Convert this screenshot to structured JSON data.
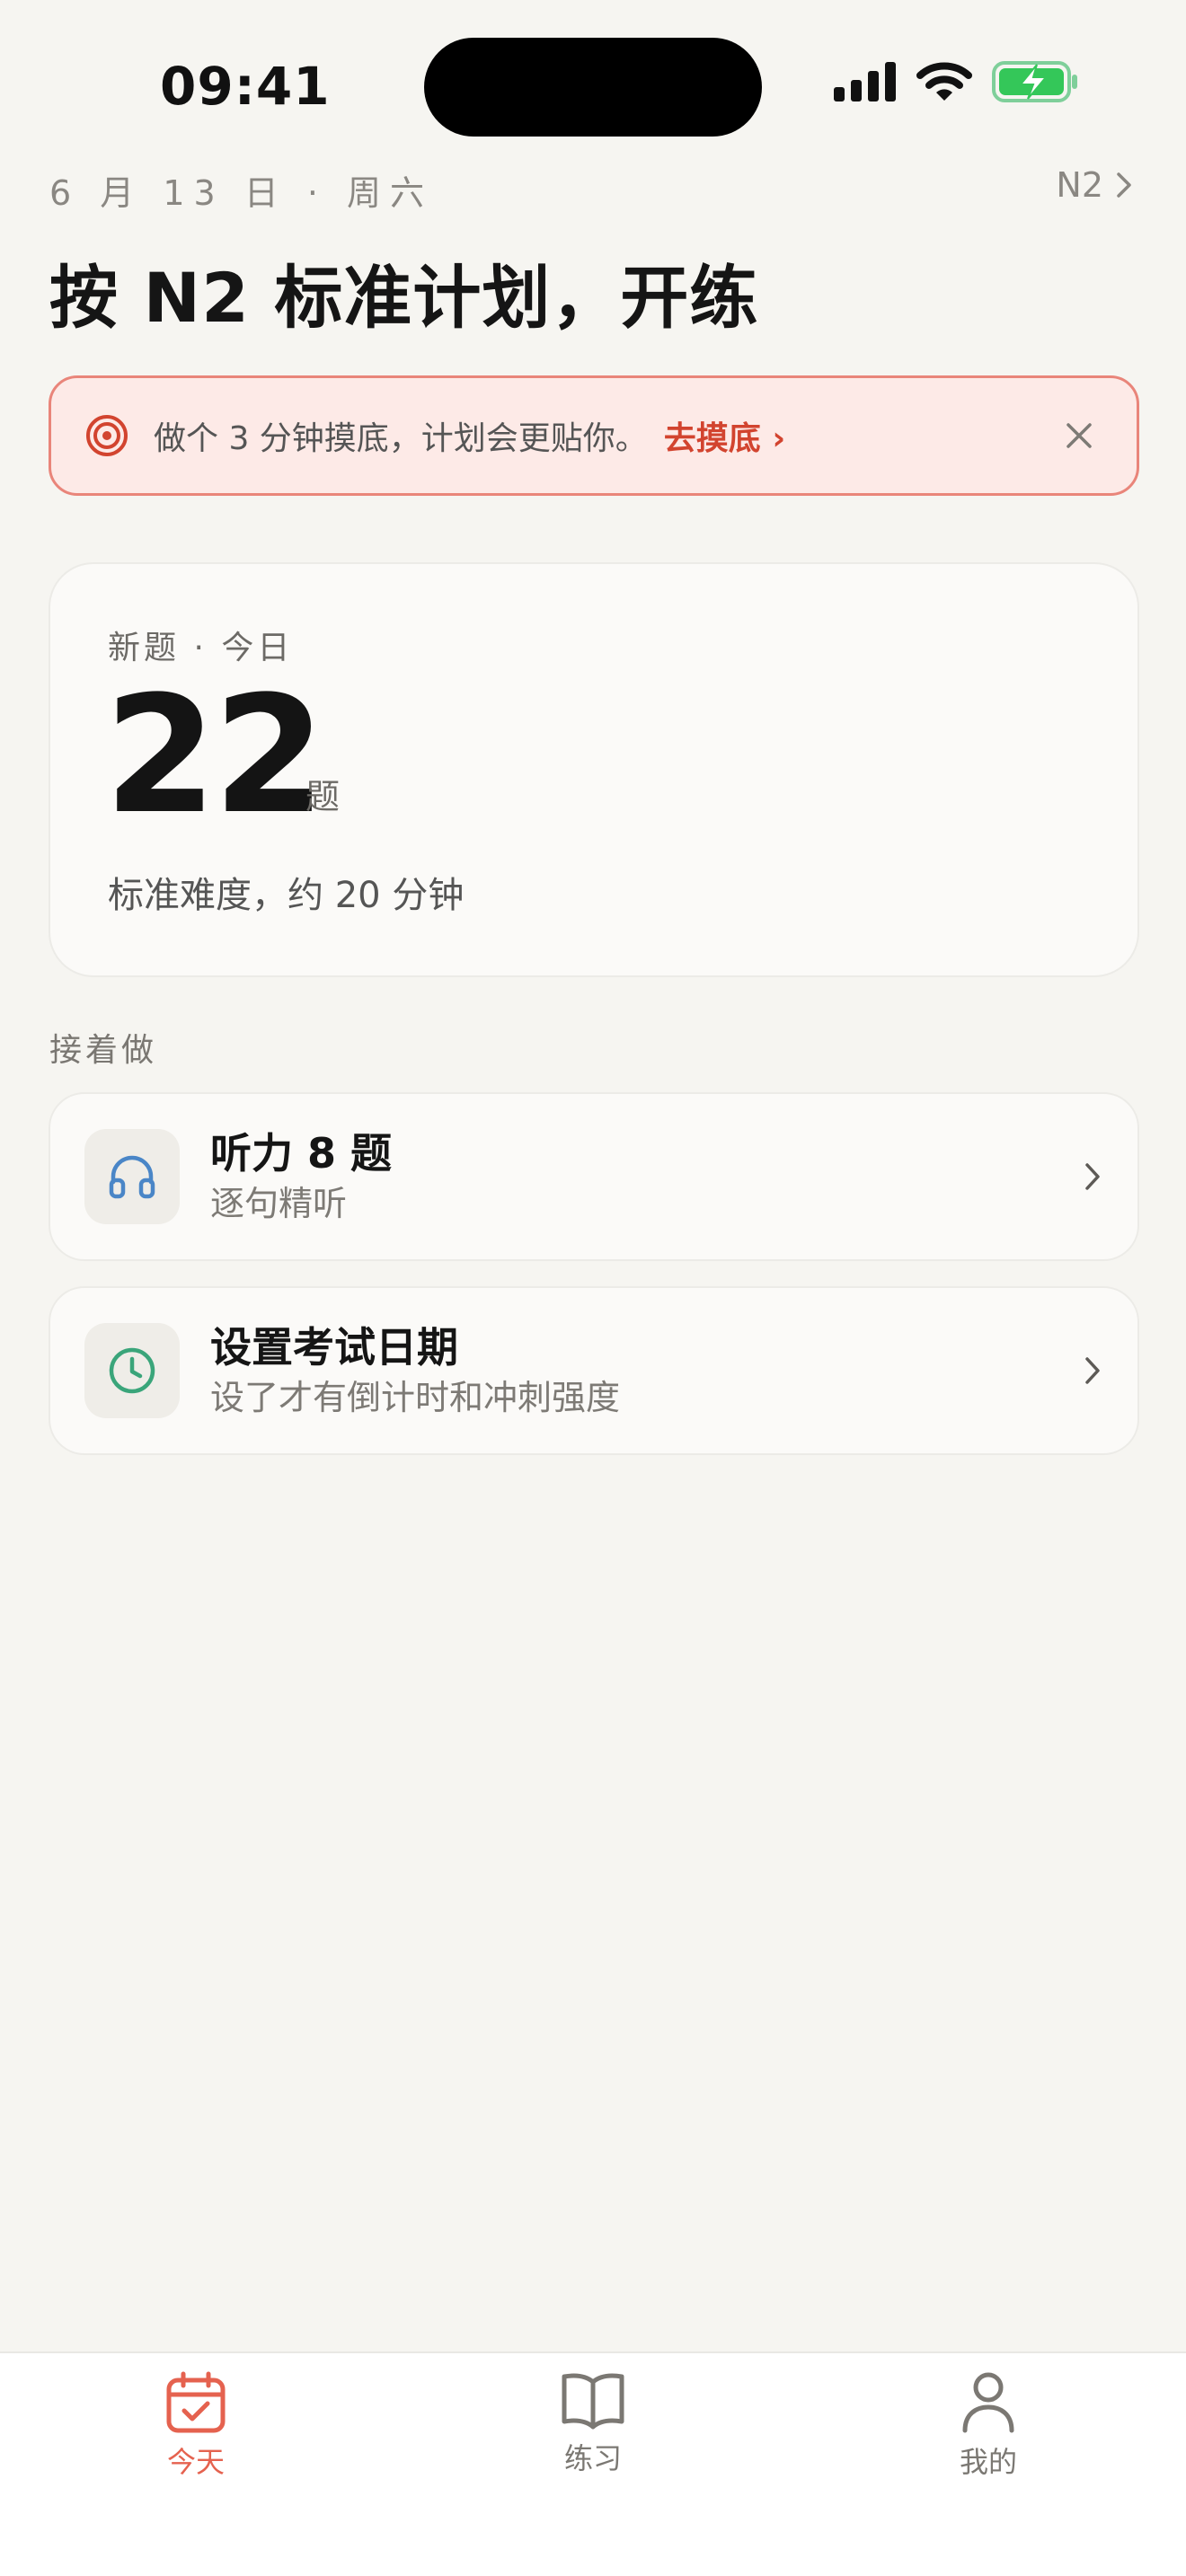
{
  "status_bar": {
    "time": "09:41",
    "icons": [
      "cellular-signal-icon",
      "wifi-icon",
      "battery-charging-icon"
    ]
  },
  "header": {
    "date": "6 月 13 日 · 周六",
    "level": "N2",
    "title": "按 N2 标准计划，开练"
  },
  "banner": {
    "text": "做个 3 分钟摸底，计划会更贴你。",
    "link": "去摸底 ›",
    "icon": "target-icon",
    "close_icon": "close-icon"
  },
  "today_card": {
    "label": "新题 · 今日",
    "count": "22",
    "unit": "题",
    "description": "标准难度，约 20 分钟"
  },
  "continue_section": {
    "label": "接着做",
    "items": [
      {
        "title": "听力 8 题",
        "subtitle": "逐句精听",
        "icon": "headphones-icon"
      },
      {
        "title": "设置考试日期",
        "subtitle": "设了才有倒计时和冲刺强度",
        "icon": "clock-icon"
      }
    ]
  },
  "tab_bar": {
    "tabs": [
      {
        "label": "今天",
        "icon": "calendar-check-icon",
        "active": true
      },
      {
        "label": "练习",
        "icon": "book-icon",
        "active": false
      },
      {
        "label": "我的",
        "icon": "person-icon",
        "active": false
      }
    ]
  },
  "colors": {
    "background": "#f6f5f1",
    "accent": "#e5624f",
    "banner_bg": "#fdeae7",
    "banner_border": "#e9857a",
    "link": "#d2442f",
    "headphones": "#4a86c7",
    "clock": "#3aa57a",
    "battery": "#34c759"
  }
}
